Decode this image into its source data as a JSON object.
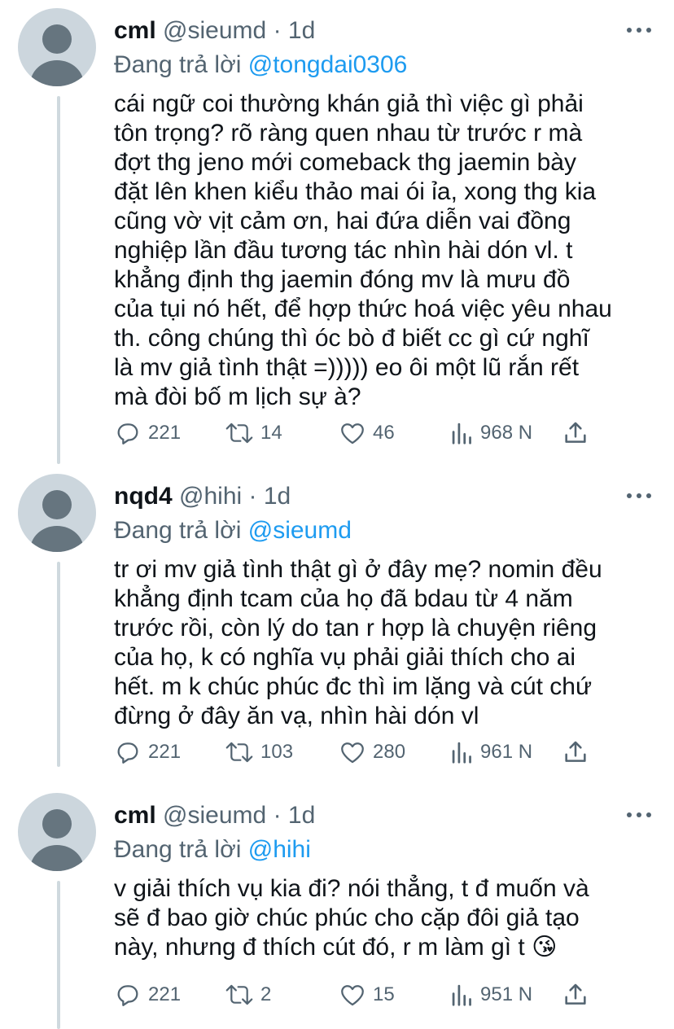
{
  "tweets": [
    {
      "name": "cml",
      "handle": "@sieumd",
      "separator": "·",
      "time": "1d",
      "reply_prefix": "Đang trả lời",
      "reply_to": "@tongdai0306",
      "lines": [
        "cái ngữ coi thường khán giả thì việc gì phải",
        "tôn trọng? rõ ràng quen nhau từ trước r mà",
        "đợt thg jeno mới comeback thg jaemin bày",
        "đặt lên khen kiểu thảo mai ói ỉa, xong thg kia",
        "cũng vờ vịt cảm ơn, hai đứa diễn vai đồng",
        "nghiệp lần đầu tương tác nhìn hài dón vl. t",
        "khẳng định thg jaemin đóng mv là mưu đồ",
        "của tụi nó hết, để hợp thức hoá việc yêu nhau",
        "th. công chúng thì óc bò đ biết cc gì cứ nghĩ",
        "là mv giả tình thật =))))) eo ôi một lũ rắn rết",
        "mà đòi bố m lịch sự à?"
      ],
      "replies": "221",
      "retweets": "14",
      "likes": "46",
      "views": "968 N"
    },
    {
      "name": "nqd4",
      "handle": "@hihi",
      "separator": "·",
      "time": "1d",
      "reply_prefix": "Đang trả lời",
      "reply_to": "@sieumd",
      "lines": [
        "tr ơi mv giả tình thật gì ở đây mẹ? nomin đều",
        "khẳng định tcam của họ đã bdau từ 4 năm",
        "trước rồi, còn lý do tan r hợp là chuyện riêng",
        "của họ, k có nghĩa vụ phải giải thích cho ai",
        "hết. m k chúc phúc đc thì im lặng và cút chứ",
        "đừng ở đây ăn vạ, nhìn hài dón vl"
      ],
      "replies": "221",
      "retweets": "103",
      "likes": "280",
      "views": "961 N"
    },
    {
      "name": "cml",
      "handle": "@sieumd",
      "separator": "·",
      "time": "1d",
      "reply_prefix": "Đang trả lời",
      "reply_to": "@hihi",
      "lines": [
        "v giải thích vụ kia đi? nói thẳng, t đ muốn và",
        "sẽ đ bao giờ chúc phúc cho cặp đôi giả tạo",
        "này, nhưng đ thích cút đó, r m làm gì t 😘"
      ],
      "replies": "221",
      "retweets": "2",
      "likes": "15",
      "views": "951 N"
    }
  ]
}
